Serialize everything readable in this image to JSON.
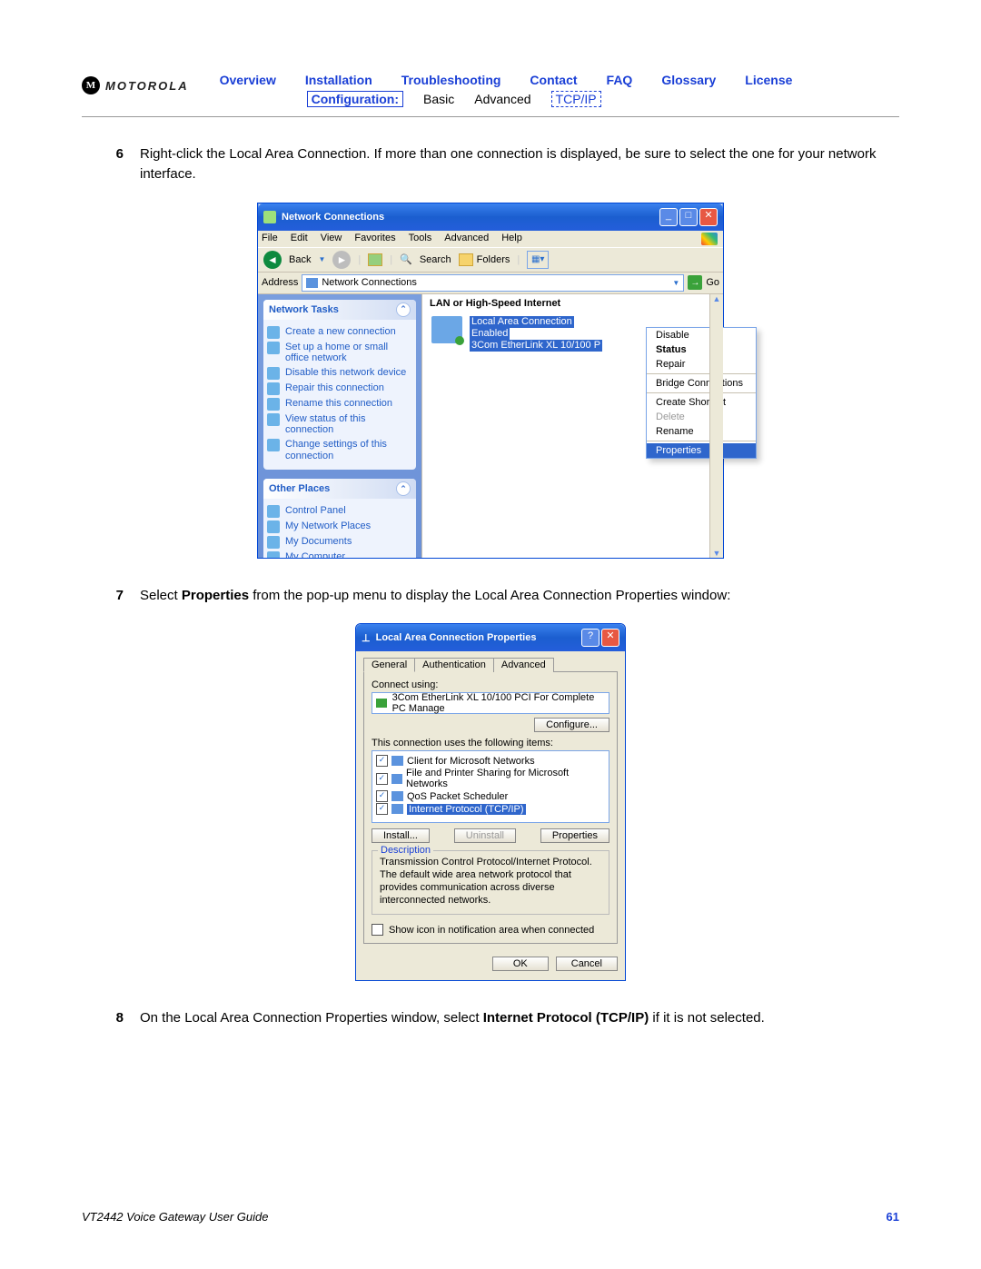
{
  "header": {
    "brand": "MOTOROLA",
    "nav": [
      "Overview",
      "Installation",
      "Troubleshooting",
      "Contact",
      "FAQ",
      "Glossary",
      "License"
    ],
    "config_label": "Configuration:",
    "config_items": {
      "basic": "Basic",
      "advanced": "Advanced",
      "tcpip": "TCP/IP"
    }
  },
  "steps": {
    "s6": {
      "num": "6",
      "text": "Right-click the Local Area Connection. If more than one connection is displayed, be sure to select the one for your network interface."
    },
    "s7": {
      "num": "7",
      "pre": "Select ",
      "bold": "Properties",
      "post": " from the pop-up menu to display the Local Area Connection Properties window:"
    },
    "s8": {
      "num": "8",
      "pre": "On the Local Area Connection Properties window, select ",
      "bold": "Internet Protocol (TCP/IP)",
      "post": " if it is not selected."
    }
  },
  "net_window": {
    "title": "Network Connections",
    "menu": [
      "File",
      "Edit",
      "View",
      "Favorites",
      "Tools",
      "Advanced",
      "Help"
    ],
    "toolbar": {
      "back": "Back",
      "search": "Search",
      "folders": "Folders"
    },
    "address_label": "Address",
    "address_value": "Network Connections",
    "go": "Go",
    "sidebar": {
      "tasks_header": "Network Tasks",
      "tasks": [
        "Create a new connection",
        "Set up a home or small office network",
        "Disable this network device",
        "Repair this connection",
        "Rename this connection",
        "View status of this connection",
        "Change settings of this connection"
      ],
      "other_header": "Other Places",
      "other": [
        "Control Panel",
        "My Network Places",
        "My Documents",
        "My Computer"
      ]
    },
    "content": {
      "section": "LAN or High-Speed Internet",
      "item": {
        "name": "Local Area Connection",
        "status": "Enabled",
        "adapter": "3Com EtherLink XL 10/100 P"
      }
    },
    "context_menu": {
      "disable": "Disable",
      "status": "Status",
      "repair": "Repair",
      "bridge": "Bridge Connections",
      "shortcut": "Create Shortcut",
      "delete": "Delete",
      "rename": "Rename",
      "properties": "Properties"
    }
  },
  "prop_window": {
    "title": "Local Area Connection Properties",
    "tabs": {
      "general": "General",
      "auth": "Authentication",
      "adv": "Advanced"
    },
    "connect_using": "Connect using:",
    "nic": "3Com EtherLink XL 10/100 PCI For Complete PC Manage",
    "configure": "Configure...",
    "uses_items": "This connection uses the following items:",
    "items": [
      "Client for Microsoft Networks",
      "File and Printer Sharing for Microsoft Networks",
      "QoS Packet Scheduler",
      "Internet Protocol (TCP/IP)"
    ],
    "install": "Install...",
    "uninstall": "Uninstall",
    "properties": "Properties",
    "desc_label": "Description",
    "desc": "Transmission Control Protocol/Internet Protocol. The default wide area network protocol that provides communication across diverse interconnected networks.",
    "show_icon": "Show icon in notification area when connected",
    "ok": "OK",
    "cancel": "Cancel"
  },
  "footer": {
    "guide": "VT2442 Voice Gateway User Guide",
    "page": "61"
  }
}
